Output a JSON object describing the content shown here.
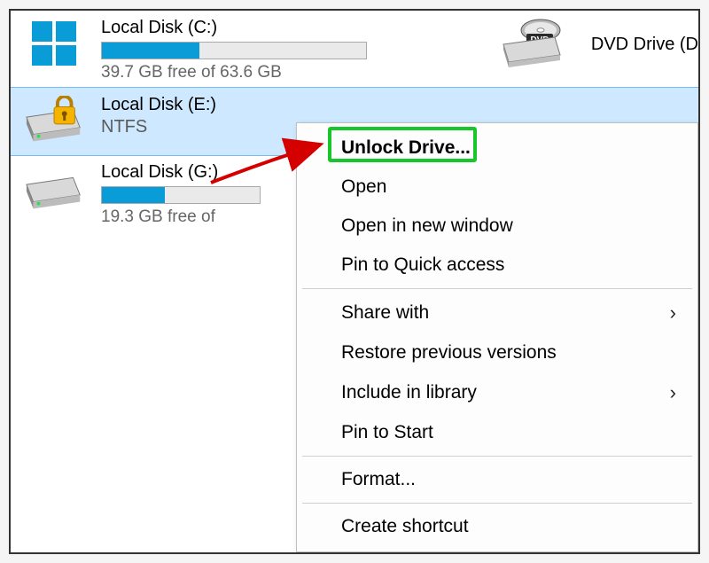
{
  "drives": {
    "c": {
      "name": "Local Disk (C:)",
      "free_text": "39.7 GB free of 63.6 GB",
      "used_pct": 37
    },
    "e": {
      "name": "Local Disk (E:)",
      "sub": "NTFS"
    },
    "g": {
      "name": "Local Disk (G:)",
      "free_text": "19.3 GB free of",
      "used_pct": 40
    },
    "dvd": {
      "name": "DVD Drive (D"
    }
  },
  "context_menu": {
    "unlock": "Unlock Drive...",
    "open": "Open",
    "open_new": "Open in new window",
    "pin_quick": "Pin to Quick access",
    "share_with": "Share with",
    "restore": "Restore previous versions",
    "include_lib": "Include in library",
    "pin_start": "Pin to Start",
    "format": "Format...",
    "create_shortcut": "Create shortcut"
  }
}
